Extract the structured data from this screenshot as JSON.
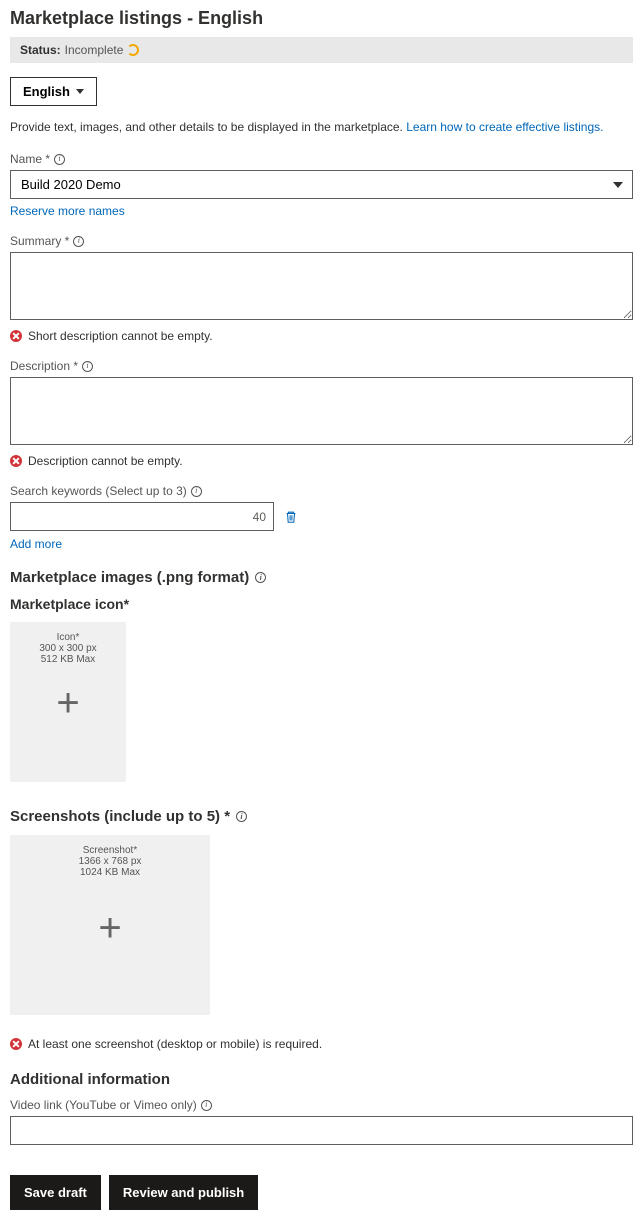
{
  "header": {
    "title": "Marketplace listings - English",
    "status_label": "Status:",
    "status_value": "Incomplete"
  },
  "language_button": "English",
  "helper_text": "Provide text, images, and other details to be displayed in the marketplace.",
  "helper_link": "Learn how to create effective listings.",
  "name": {
    "label": "Name *",
    "value": "Build 2020 Demo",
    "reserve_link": "Reserve more names"
  },
  "summary": {
    "label": "Summary *",
    "error": "Short description cannot be empty."
  },
  "description": {
    "label": "Description *",
    "error": "Description cannot be empty."
  },
  "keywords": {
    "label": "Search keywords (Select up to 3)",
    "count": "40",
    "add_more": "Add more"
  },
  "images": {
    "section_title": "Marketplace images (.png format)",
    "icon_title": "Marketplace icon*",
    "icon_box": {
      "title": "Icon*",
      "size": "300 x 300 px",
      "max": "512 KB Max"
    },
    "screenshots_title": "Screenshots (include up to 5) *",
    "screenshot_box": {
      "title": "Screenshot*",
      "size": "1366 x 768 px",
      "max": "1024 KB Max"
    },
    "screenshot_error": "At least one screenshot (desktop or mobile) is required."
  },
  "additional": {
    "title": "Additional information",
    "video_label": "Video link (YouTube or Vimeo only)"
  },
  "footer": {
    "save": "Save draft",
    "publish": "Review and publish"
  }
}
